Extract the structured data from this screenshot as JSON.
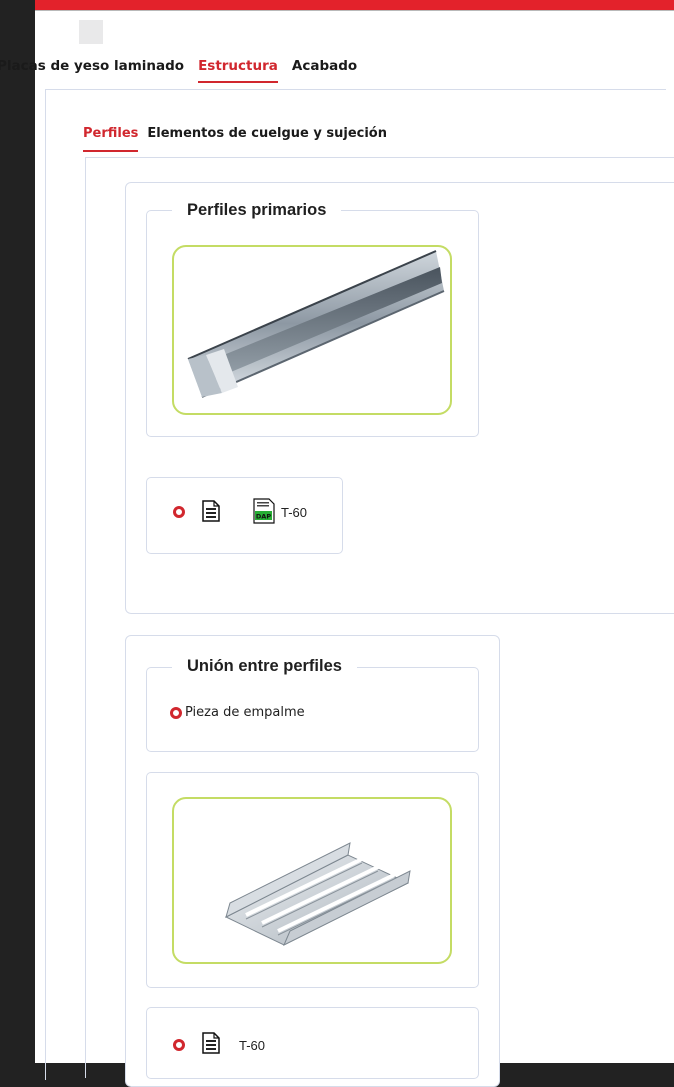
{
  "tabs_main": [
    {
      "label": "Placas de yeso laminado",
      "active": false
    },
    {
      "label": "Estructura",
      "active": true
    },
    {
      "label": "Acabado",
      "active": false
    }
  ],
  "tabs_sub": [
    {
      "label": "Perfiles",
      "active": true
    },
    {
      "label": "Elementos de cuelgue y sujeción",
      "active": false
    }
  ],
  "groups": {
    "primarios": {
      "title": "Perfiles primarios",
      "image_alt": "perfil-primario-image",
      "action": {
        "doc_icon": "document-icon",
        "dap_icon": "dap-icon",
        "dap_text": "DAP",
        "label": "T-60"
      }
    },
    "union": {
      "title": "Unión entre perfiles",
      "option": "Pieza de empalme",
      "image_alt": "pieza-empalme-image",
      "action": {
        "doc_icon": "document-icon",
        "label": "T-60"
      }
    }
  },
  "colors": {
    "accent": "#d1272e",
    "image_border": "#c4dc64",
    "panel_border": "#d6dcea",
    "background": "#222222"
  }
}
